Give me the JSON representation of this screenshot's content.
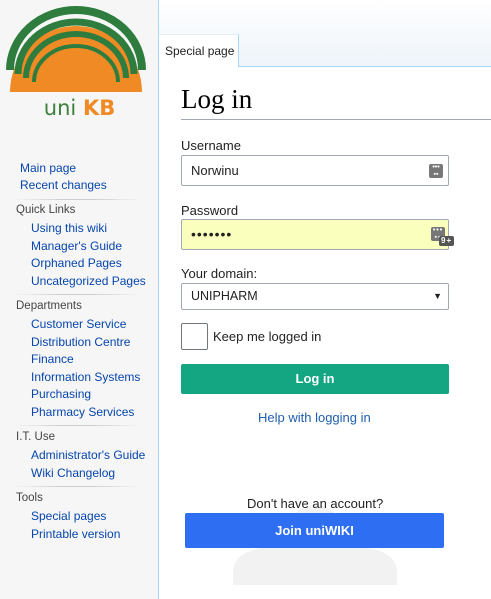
{
  "logo": {
    "text_a": "uni",
    "text_b": "KB",
    "colors": {
      "green": "#2f7d3e",
      "orange": "#f08a24"
    }
  },
  "sidebar": {
    "main": [
      {
        "label": "Main page"
      },
      {
        "label": "Recent changes"
      }
    ],
    "sections": [
      {
        "heading": "Quick Links",
        "items": [
          "Using this wiki",
          "Manager's Guide",
          "Orphaned Pages",
          "Uncategorized Pages"
        ]
      },
      {
        "heading": "Departments",
        "items": [
          "Customer Service",
          "Distribution Centre",
          "Finance",
          "Information Systems",
          "Purchasing",
          "Pharmacy Services"
        ]
      },
      {
        "heading": "I.T. Use",
        "items": [
          "Administrator's Guide",
          "Wiki Changelog"
        ]
      },
      {
        "heading": "Tools",
        "items": [
          "Special pages",
          "Printable version"
        ]
      }
    ]
  },
  "tabs": {
    "special": "Special page"
  },
  "page": {
    "title": "Log in"
  },
  "form": {
    "username_label": "Username",
    "username_value": "Norwinu",
    "password_label": "Password",
    "password_value": "•••••••",
    "password_badge": "9+",
    "domain_label": "Your domain:",
    "domain_value": "UNIPHARM",
    "remember_label": "Keep me logged in",
    "login_button": "Log in",
    "help_link": "Help with logging in",
    "no_account": "Don't have an account?",
    "join_button": "Join uniWIKI"
  },
  "colors": {
    "login": "#14a583",
    "join": "#2d6ef2",
    "link": "#0645ad",
    "autofill": "#faffbd"
  }
}
